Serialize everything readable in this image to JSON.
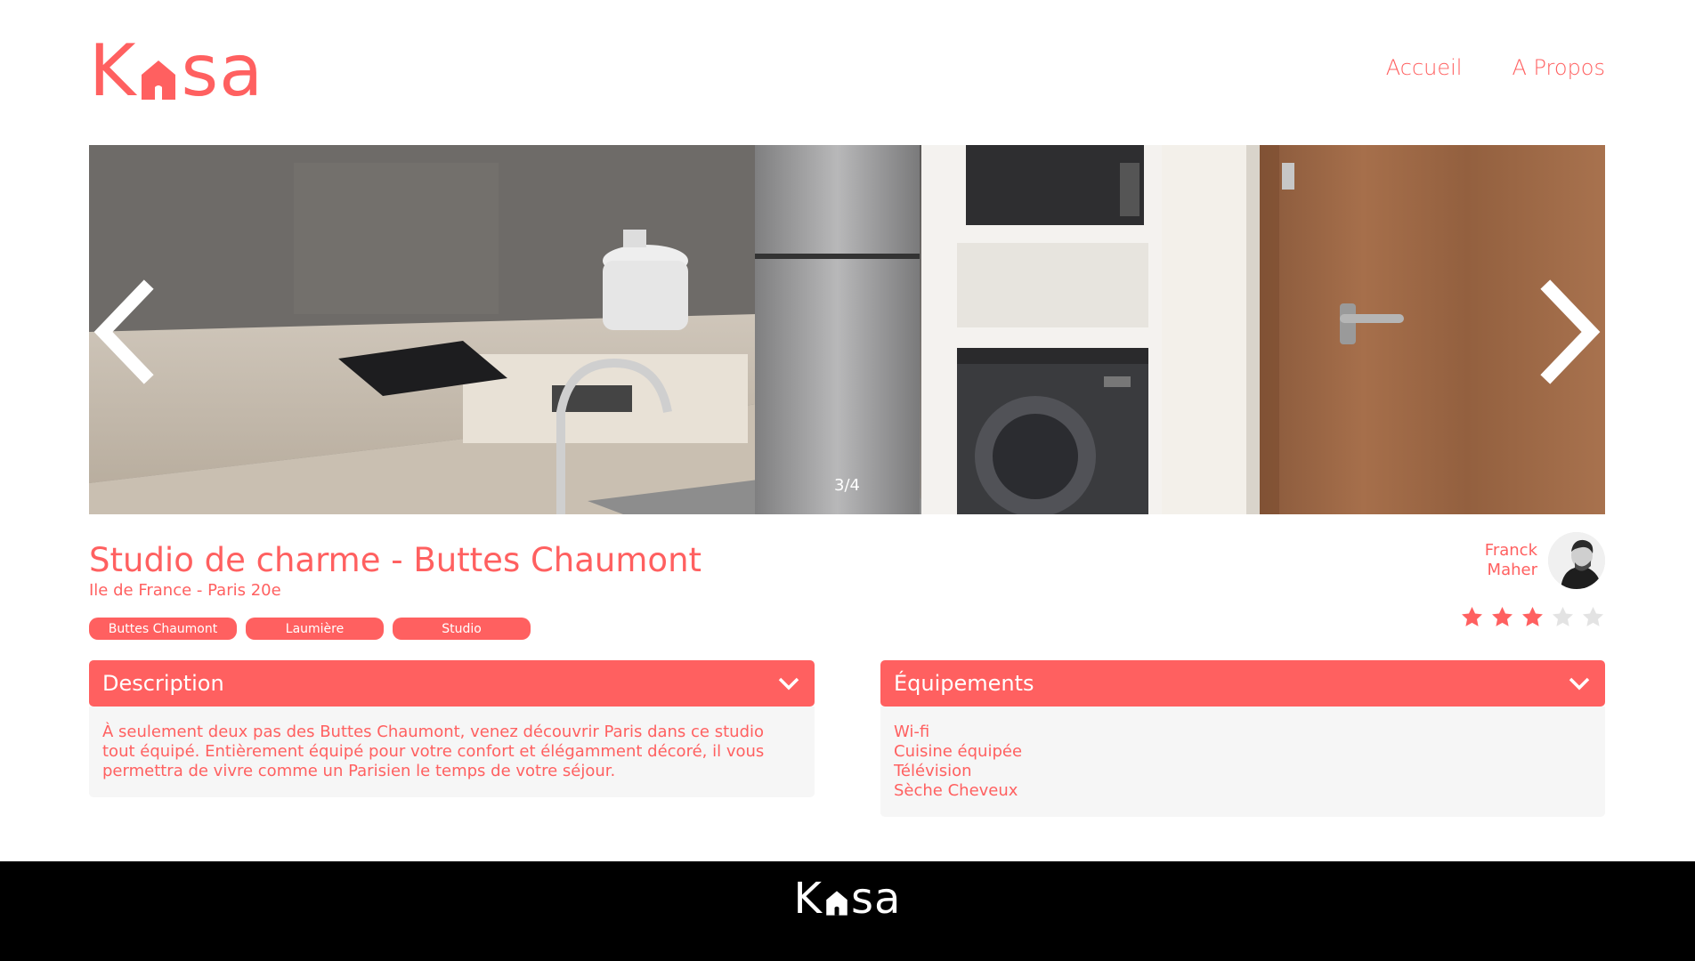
{
  "brand": {
    "name_left": "K",
    "name_right": "sa",
    "color": "#FF6060"
  },
  "nav": {
    "home": "Accueil",
    "about": "A Propos"
  },
  "carousel": {
    "counter": "3/4",
    "current": 3,
    "total": 4,
    "prev_icon": "chevron-left-icon",
    "next_icon": "chevron-right-icon"
  },
  "listing": {
    "title": "Studio de charme - Buttes Chaumont",
    "location": "Ile de France - Paris 20e",
    "tags": [
      "Buttes Chaumont",
      "Laumière",
      "Studio"
    ]
  },
  "host": {
    "first_name": "Franck",
    "last_name": "Maher"
  },
  "rating": {
    "value": 3,
    "max": 5,
    "filled_color": "#FF6060",
    "empty_color": "#E3E3E3"
  },
  "description": {
    "title": "Description",
    "text": "À seulement deux pas des Buttes Chaumont, venez découvrir Paris dans ce studio tout équipé. Entièrement équipé pour votre confort et élégamment décoré, il vous permettra de vivre comme un Parisien le temps de votre séjour."
  },
  "equipments": {
    "title": "Équipements",
    "items": [
      "Wi-fi",
      "Cuisine équipée",
      "Télévision",
      "Sèche Cheveux"
    ]
  },
  "footer": {
    "background": "#000000",
    "logo_color": "#FFFFFF"
  }
}
